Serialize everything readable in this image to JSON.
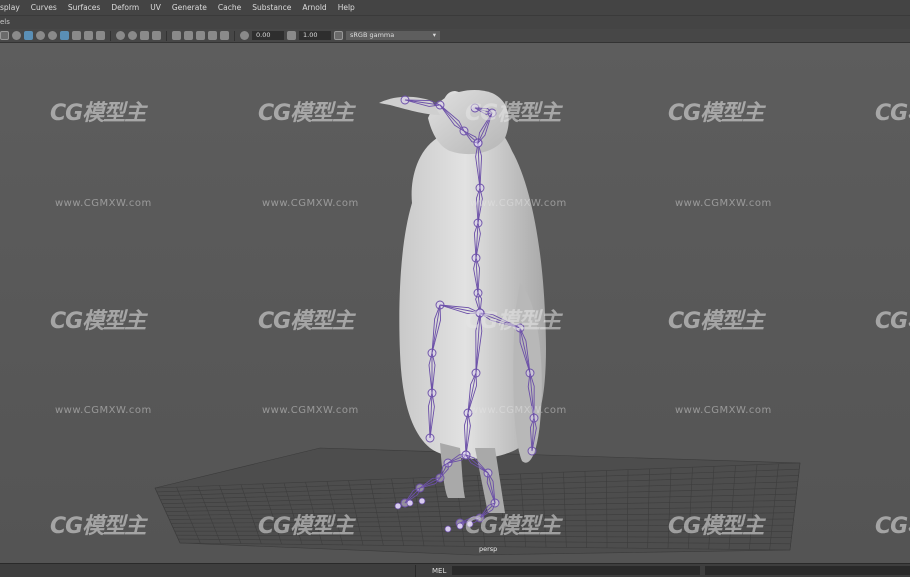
{
  "menu": [
    "splay",
    "Curves",
    "Surfaces",
    "Deform",
    "UV",
    "Generate",
    "Cache",
    "Substance",
    "Arnold",
    "Help"
  ],
  "panel_menu": "els",
  "toolbar": {
    "exposure_value": "0.00",
    "gamma_value": "1.00",
    "color_space": "sRGB gamma"
  },
  "viewport": {
    "camera_label": "persp",
    "watermark_logo": "CG模型主",
    "watermark_url": "www.CGMXW.com"
  },
  "status": {
    "command_lang": "MEL"
  },
  "colors": {
    "background": "#555555",
    "joint": "#6b4fa8",
    "grid": "#3e3e3e"
  }
}
